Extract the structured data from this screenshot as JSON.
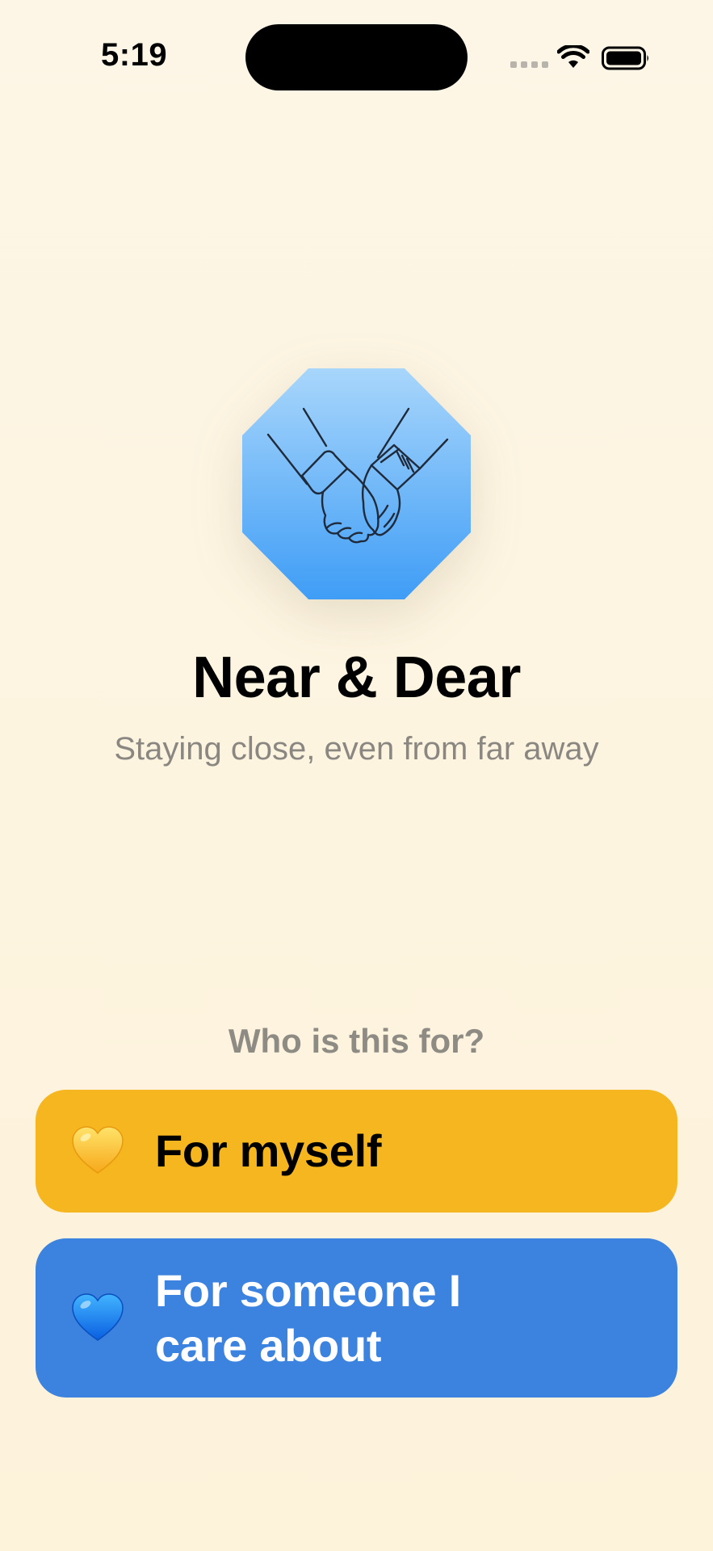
{
  "status_bar": {
    "time": "5:19",
    "icons": [
      "cellular-signal-icon",
      "wifi-icon",
      "battery-icon"
    ]
  },
  "app": {
    "icon": "holding-hands-icon",
    "title": "Near & Dear",
    "subtitle": "Staying close, even from far away"
  },
  "onboarding": {
    "question": "Who is this for?",
    "options": [
      {
        "icon": "yellow-heart-icon",
        "label": "For myself",
        "color": "#f6b61f"
      },
      {
        "icon": "blue-heart-icon",
        "label": "For someone I care about",
        "color": "#3b83de"
      }
    ]
  },
  "colors": {
    "background": "#fdf6e6",
    "icon_gradient_top": "#a8d6fb",
    "icon_gradient_bottom": "#3f9df6",
    "secondary_text": "#8a8782"
  }
}
